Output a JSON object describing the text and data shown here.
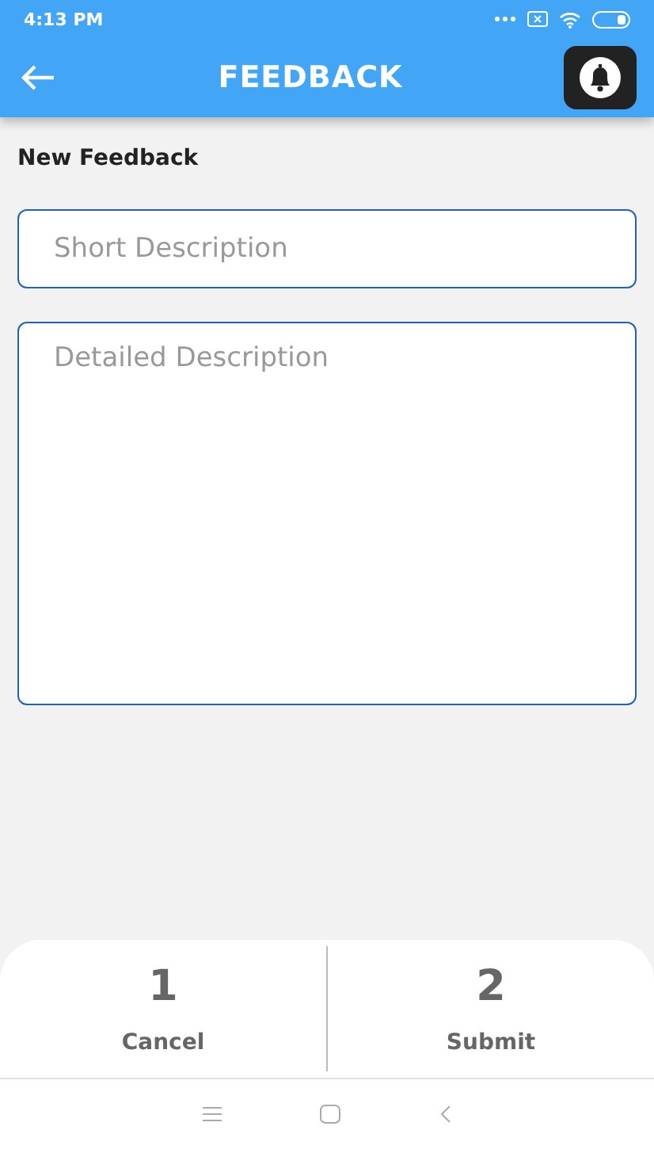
{
  "status_bar": {
    "time": "4:13 PM"
  },
  "app_bar": {
    "title": "FEEDBACK"
  },
  "section_title": "New Feedback",
  "fields": [
    {
      "placeholder": "Short Description",
      "kind": "single"
    },
    {
      "placeholder": "Detailed Description",
      "kind": "multi"
    }
  ],
  "actions": [
    {
      "number": "1",
      "label": "Cancel"
    },
    {
      "number": "2",
      "label": "Submit"
    }
  ]
}
